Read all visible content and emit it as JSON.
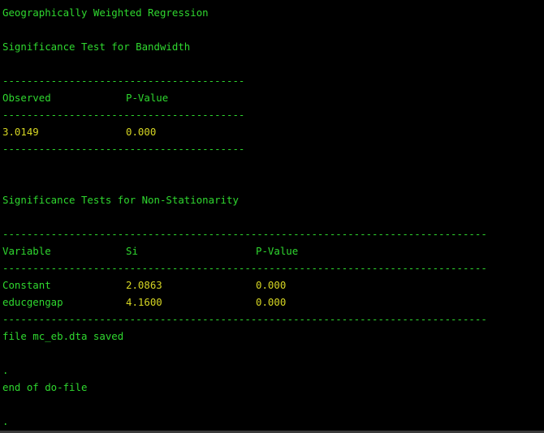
{
  "output": {
    "gwr_title": "Geographically Weighted Regression",
    "bandwidth_title": "Significance Test for Bandwidth",
    "rule_short": "----------------------------------------",
    "rule_long": "--------------------------------------------------------------------------------",
    "bandwidth_table": {
      "headers": [
        "Observed",
        "P-Value"
      ],
      "row": [
        "3.0149",
        "0.000"
      ]
    },
    "nonstat_title": "Significance Tests for Non-Stationarity",
    "nonstat_table": {
      "headers": [
        "Variable",
        "Si",
        "P-Value"
      ],
      "rows": [
        [
          "Constant",
          "2.0863",
          "0.000"
        ],
        [
          "educgengap",
          "4.1600",
          "0.000"
        ]
      ]
    },
    "saved_message": "file mc_eb.dta saved",
    "prompt_dot_1": ".",
    "end_message": "end of do-file",
    "prompt_dot_2": "."
  },
  "colors": {
    "background": "#000000",
    "text_green": "#2fd82f",
    "result_yellow": "#d6d623"
  }
}
